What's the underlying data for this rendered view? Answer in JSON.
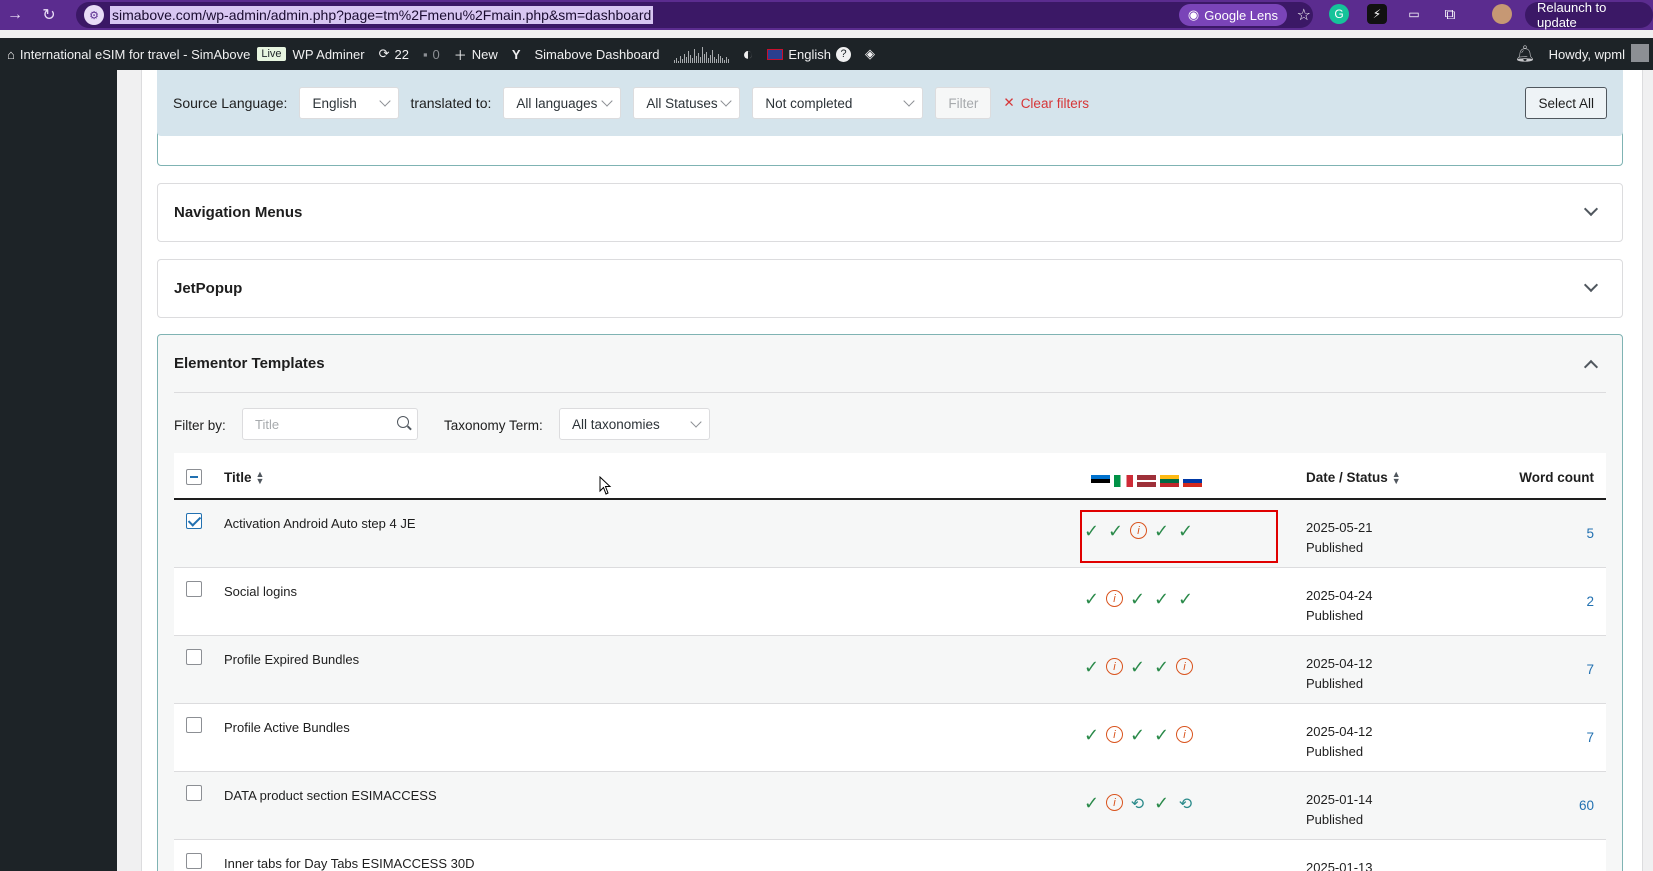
{
  "browser": {
    "url": "simabove.com/wp-admin/admin.php?page=tm%2Fmenu%2Fmain.php&sm=dashboard",
    "lens_label": "Google Lens",
    "relaunch_label": "Relaunch to update"
  },
  "adminbar": {
    "site_name": "International eSIM for travel - SimAbove",
    "live_badge": "Live",
    "wp_adminer": "WP Adminer",
    "updates_count": "22",
    "comments_count": "0",
    "new_label": "New",
    "dashboard_label": "Simabove Dashboard",
    "language_label": "English",
    "howdy": "Howdy, wpml"
  },
  "filters": {
    "source_language_label": "Source Language:",
    "source_language_value": "English",
    "translated_to_label": "translated to:",
    "translated_to_value": "All languages",
    "status_value": "All Statuses",
    "completion_value": "Not completed",
    "filter_button": "Filter",
    "clear_filters": "Clear filters",
    "select_all": "Select All"
  },
  "sections": {
    "nav_menus": "Navigation Menus",
    "jetpopup": "JetPopup",
    "elementor": "Elementor Templates"
  },
  "elementor": {
    "filter_by_label": "Filter by:",
    "title_placeholder": "Title",
    "taxonomy_label": "Taxonomy Term:",
    "taxonomy_value": "All taxonomies"
  },
  "table": {
    "headers": {
      "title": "Title",
      "date_status": "Date / Status",
      "word_count": "Word count"
    },
    "flags": [
      "flag-ee",
      "flag-it",
      "flag-lv",
      "flag-lt",
      "flag-ru"
    ],
    "rows": [
      {
        "title": "Activation Android Auto step 4 JE",
        "date": "2025-05-21",
        "status": "Published",
        "words": "5",
        "checked": true,
        "icons": [
          "check",
          "check",
          "info",
          "check",
          "check"
        ]
      },
      {
        "title": "Social logins",
        "date": "2025-04-24",
        "status": "Published",
        "words": "2",
        "checked": false,
        "icons": [
          "check",
          "info",
          "check",
          "check",
          "check"
        ]
      },
      {
        "title": "Profile Expired Bundles",
        "date": "2025-04-12",
        "status": "Published",
        "words": "7",
        "checked": false,
        "icons": [
          "check",
          "info",
          "check",
          "check",
          "info"
        ]
      },
      {
        "title": "Profile Active Bundles",
        "date": "2025-04-12",
        "status": "Published",
        "words": "7",
        "checked": false,
        "icons": [
          "check",
          "info",
          "check",
          "check",
          "info"
        ]
      },
      {
        "title": "DATA product section ESIMACCESS",
        "date": "2025-01-14",
        "status": "Published",
        "words": "60",
        "checked": false,
        "icons": [
          "check",
          "info",
          "sync",
          "check",
          "sync"
        ]
      },
      {
        "title": "Inner tabs for Day Tabs ESIMACCESS 30D",
        "date": "2025-01-13",
        "status": "",
        "words": "",
        "checked": false,
        "icons": []
      }
    ]
  }
}
